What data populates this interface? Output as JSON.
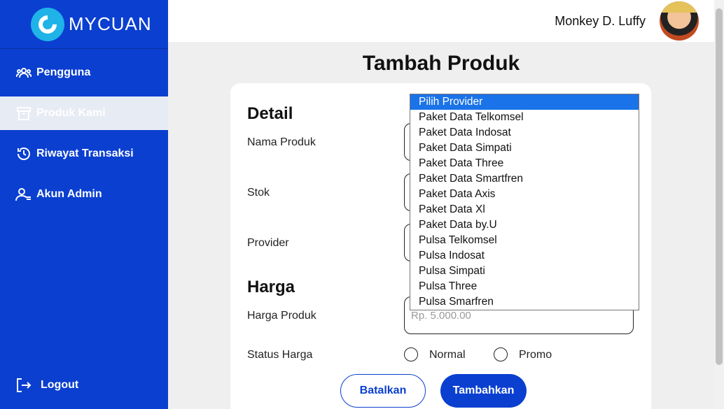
{
  "brand": {
    "name": "MYCUAN"
  },
  "sidebar": {
    "items": [
      {
        "label": "Pengguna",
        "icon": "users-icon"
      },
      {
        "label": "Produk Kami",
        "icon": "archive-icon",
        "active": true
      },
      {
        "label": "Riwayat Transaksi",
        "icon": "history-icon"
      },
      {
        "label": "Akun Admin",
        "icon": "user-admin-icon"
      }
    ],
    "logout": {
      "label": "Logout",
      "icon": "logout-icon"
    }
  },
  "header": {
    "username": "Monkey D. Luffy"
  },
  "page": {
    "title": "Tambah Produk"
  },
  "form": {
    "detail_title": "Detail",
    "nama_label": "Nama Produk",
    "stok_label": "Stok",
    "provider_label": "Provider",
    "harga_title": "Harga",
    "harga_label": "Harga Produk",
    "harga_placeholder": "Rp. 5.000.00",
    "status_label": "Status Harga",
    "status_options": [
      "Normal",
      "Promo"
    ],
    "cancel_label": "Batalkan",
    "submit_label": "Tambahkan"
  },
  "provider_dropdown": {
    "selected": "Pilih Provider",
    "options": [
      "Pilih Provider",
      "Paket Data Telkomsel",
      "Paket Data Indosat",
      "Paket Data Simpati",
      "Paket Data Three",
      "Paket Data Smartfren",
      "Paket Data Axis",
      "Paket Data Xl",
      "Paket Data by.U",
      "Pulsa Telkomsel",
      "Pulsa Indosat",
      "Pulsa Simpati",
      "Pulsa Three",
      "Pulsa Smarfren"
    ]
  },
  "colors": {
    "primary": "#0a3fd0",
    "logo": "#1fb3e8",
    "highlight": "#1a73e8"
  }
}
